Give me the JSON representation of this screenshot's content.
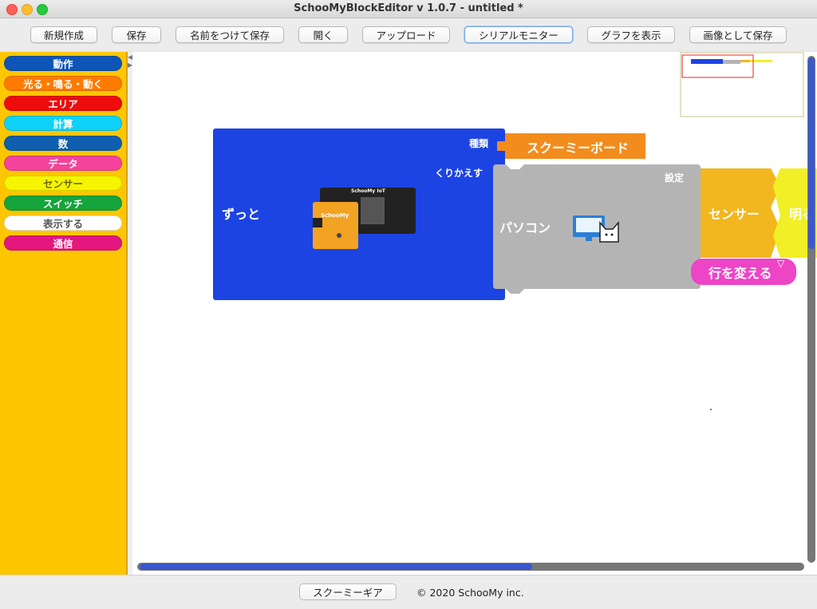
{
  "window": {
    "title": "SchooMyBlockEditor v 1.0.7 - untitled *"
  },
  "toolbar": {
    "new": "新規作成",
    "save": "保存",
    "save_as": "名前をつけて保存",
    "open": "開く",
    "upload": "アップロード",
    "serial_monitor": "シリアルモニター",
    "show_graph": "グラフを表示",
    "save_image": "画像として保存"
  },
  "palette": [
    {
      "label": "動作",
      "color": "#0f55b7"
    },
    {
      "label": "光る・鳴る・動く",
      "color": "#ff7a00"
    },
    {
      "label": "エリア",
      "color": "#ee0c0c"
    },
    {
      "label": "計算",
      "color": "#0fd2f8"
    },
    {
      "label": "数",
      "color": "#0f5fae"
    },
    {
      "label": "データ",
      "color": "#f4439a"
    },
    {
      "label": "センサー",
      "color": "#f7f400"
    },
    {
      "label": "スイッチ",
      "color": "#16a43c"
    },
    {
      "label": "表示する",
      "color": "#ffffff"
    },
    {
      "label": "通信",
      "color": "#e3177d"
    }
  ],
  "blocks": {
    "forever": {
      "label": "ずっと",
      "color": "#1c44e2"
    },
    "type_label": "種類",
    "board": {
      "label": "スクーミーボード",
      "color": "#f28c1c"
    },
    "repeat_label": "くりかえす",
    "pc": {
      "label": "パソコン",
      "color": "#b4b4b4"
    },
    "setting_label": "設定",
    "sensor": {
      "label": "センサー",
      "color": "#f2b61f"
    },
    "bright": {
      "label": "明る",
      "color": "#f1ef25"
    },
    "newline": {
      "label": "行を変える",
      "color": "#ee44c6"
    },
    "device_text": {
      "board_top": "SchooMy IoT",
      "board_front": "SchooMy"
    },
    "icons": [
      "circuit-board-icon",
      "computer-cat-icon"
    ]
  },
  "footer": {
    "gear_button": "スクーミーギア",
    "copyright": "© 2020 SchooMy inc."
  }
}
